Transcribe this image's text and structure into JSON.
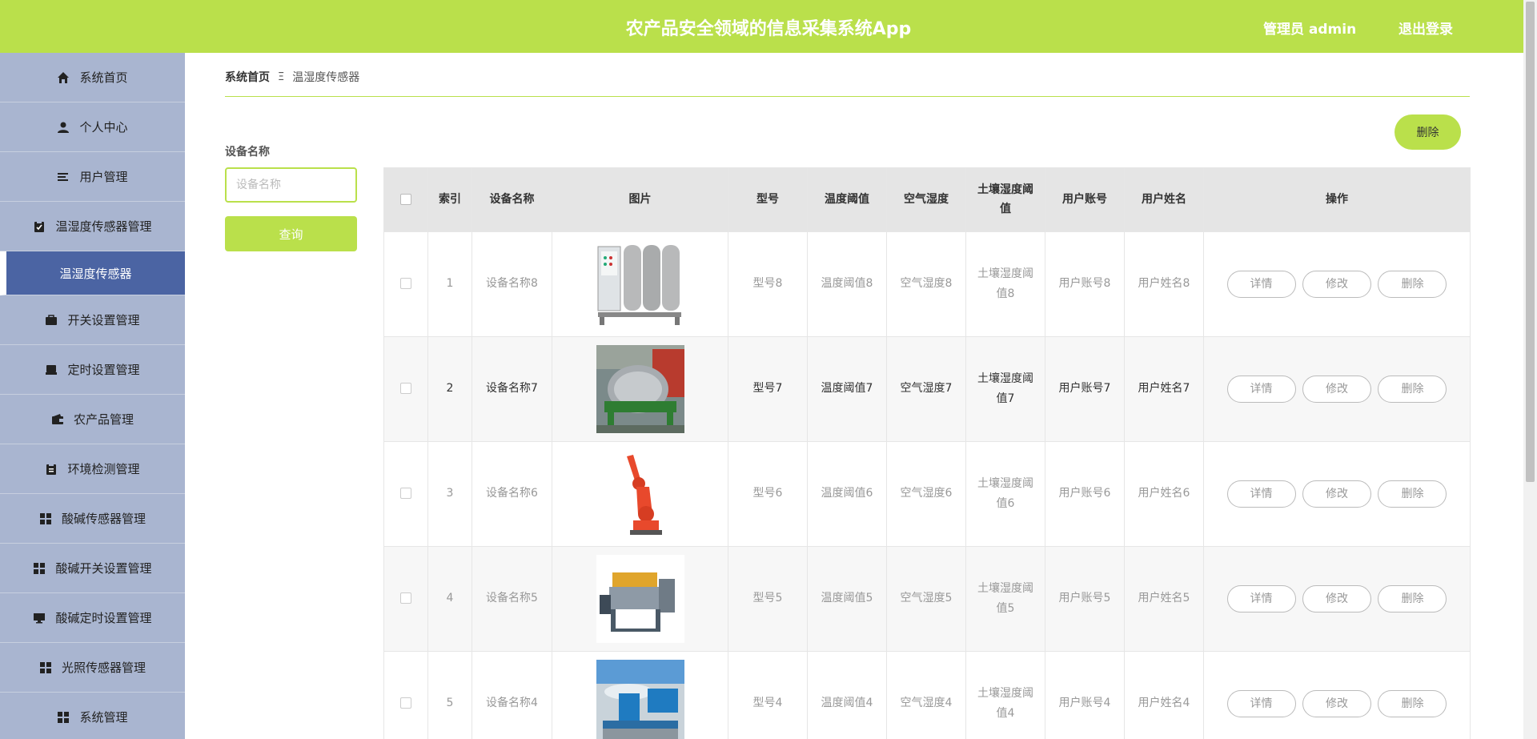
{
  "header": {
    "title": "农产品安全领域的信息采集系统App",
    "admin": "管理员 admin",
    "logout": "退出登录"
  },
  "sidebar": {
    "items": [
      {
        "label": "系统首页",
        "icon": "home-icon"
      },
      {
        "label": "个人中心",
        "icon": "user-icon"
      },
      {
        "label": "用户管理",
        "icon": "list-icon"
      },
      {
        "label": "温湿度传感器管理",
        "icon": "clipboard-check-icon"
      },
      {
        "label": "温湿度传感器",
        "icon": ""
      },
      {
        "label": "开关设置管理",
        "icon": "briefcase-icon"
      },
      {
        "label": "定时设置管理",
        "icon": "inbox-icon"
      },
      {
        "label": "农产品管理",
        "icon": "wallet-icon"
      },
      {
        "label": "环境检测管理",
        "icon": "clipboard-icon"
      },
      {
        "label": "酸碱传感器管理",
        "icon": "grid-icon"
      },
      {
        "label": "酸碱开关设置管理",
        "icon": "grid-icon"
      },
      {
        "label": "酸碱定时设置管理",
        "icon": "monitor-icon"
      },
      {
        "label": "光照传感器管理",
        "icon": "grid-icon"
      },
      {
        "label": "系统管理",
        "icon": "grid-icon"
      }
    ]
  },
  "breadcrumb": {
    "home": "系统首页",
    "separator": "Ξ",
    "current": "温湿度传感器"
  },
  "search": {
    "label": "设备名称",
    "placeholder": "设备名称",
    "query_label": "查询"
  },
  "toolbar": {
    "delete_label": "删除"
  },
  "table": {
    "headers": [
      "索引",
      "设备名称",
      "图片",
      "型号",
      "温度阈值",
      "空气湿度",
      "土壤湿度阈值",
      "用户账号",
      "用户姓名",
      "操作"
    ],
    "rows": [
      {
        "index": "1",
        "name": "设备名称8",
        "image": "water-treatment-machine",
        "model": "型号8",
        "temp": "温度阈值8",
        "air": "空气湿度8",
        "soil": "土壤湿度阈值8",
        "account": "用户账号8",
        "username": "用户姓名8"
      },
      {
        "index": "2",
        "name": "设备名称7",
        "image": "industrial-drum-machine",
        "model": "型号7",
        "temp": "温度阈值7",
        "air": "空气湿度7",
        "soil": "土壤湿度阈值7",
        "account": "用户账号7",
        "username": "用户姓名7"
      },
      {
        "index": "3",
        "name": "设备名称6",
        "image": "orange-robot-arm",
        "model": "型号6",
        "temp": "温度阈值6",
        "air": "空气湿度6",
        "soil": "土壤湿度阈值6",
        "account": "用户账号6",
        "username": "用户姓名6"
      },
      {
        "index": "4",
        "name": "设备名称5",
        "image": "welding-machine",
        "model": "型号5",
        "temp": "温度阈值5",
        "air": "空气湿度5",
        "soil": "土壤湿度阈值5",
        "account": "用户账号5",
        "username": "用户姓名5"
      },
      {
        "index": "5",
        "name": "设备名称4",
        "image": "blue-positioner-machine",
        "model": "型号4",
        "temp": "温度阈值4",
        "air": "空气湿度4",
        "soil": "土壤湿度阈值4",
        "account": "用户账号4",
        "username": "用户姓名4"
      }
    ],
    "actions": {
      "detail": "详情",
      "edit": "修改",
      "delete": "删除"
    }
  },
  "colors": {
    "accent": "#bae04b",
    "sidebar": "#a9b5d0",
    "sidebar_active": "#4b64a3"
  }
}
